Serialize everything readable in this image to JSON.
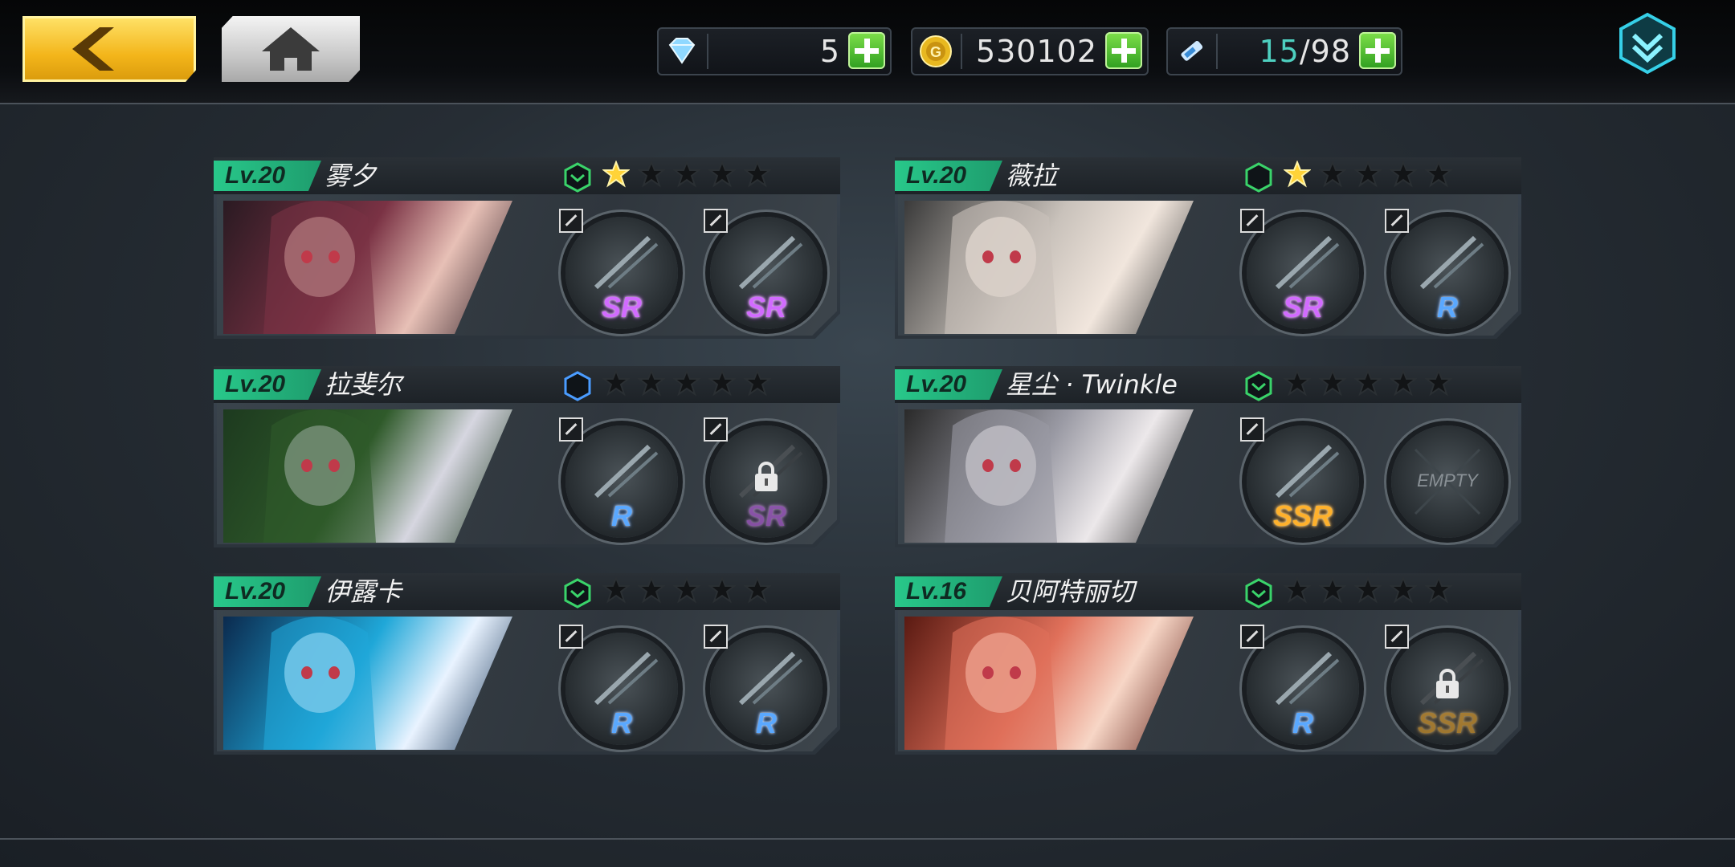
{
  "currency": {
    "gems": {
      "value": "5",
      "icon": "diamond-icon"
    },
    "gold": {
      "value": "530102",
      "icon": "gold-coin-icon"
    },
    "stamina": {
      "current": "15",
      "max": "/98",
      "icon": "syringe-icon"
    }
  },
  "nav": {
    "back": "back-arrow-icon",
    "home": "home-icon",
    "menu": "dropdown-menu-icon"
  },
  "characters": [
    {
      "level": "Lv.20",
      "name": "雾夕",
      "rank_color": "#3ad36a",
      "stars": 1,
      "weapons": [
        {
          "rarity": "SR",
          "locked": false
        },
        {
          "rarity": "SR",
          "locked": false
        }
      ]
    },
    {
      "level": "Lv.20",
      "name": "薇拉",
      "rank_color": "#3ad36a",
      "stars": 1,
      "weapons": [
        {
          "rarity": "SR",
          "locked": false
        },
        {
          "rarity": "R",
          "locked": false
        }
      ]
    },
    {
      "level": "Lv.20",
      "name": "拉斐尔",
      "rank_color": "#4a9cff",
      "stars": 0,
      "weapons": [
        {
          "rarity": "R",
          "locked": false
        },
        {
          "rarity": "SR",
          "locked": true
        }
      ]
    },
    {
      "level": "Lv.20",
      "name": "星尘 · Twinkle",
      "rank_color": "#3ad36a",
      "stars": 0,
      "weapons": [
        {
          "rarity": "SSR",
          "locked": false
        },
        {
          "rarity": "EMPTY",
          "locked": false
        }
      ]
    },
    {
      "level": "Lv.20",
      "name": "伊露卡",
      "rank_color": "#3ad36a",
      "stars": 0,
      "weapons": [
        {
          "rarity": "R",
          "locked": false
        },
        {
          "rarity": "R",
          "locked": false
        }
      ]
    },
    {
      "level": "Lv.16",
      "name": "贝阿特丽切",
      "rank_color": "#3ad36a",
      "stars": 0,
      "weapons": [
        {
          "rarity": "R",
          "locked": false
        },
        {
          "rarity": "SSR",
          "locked": true
        }
      ]
    }
  ]
}
